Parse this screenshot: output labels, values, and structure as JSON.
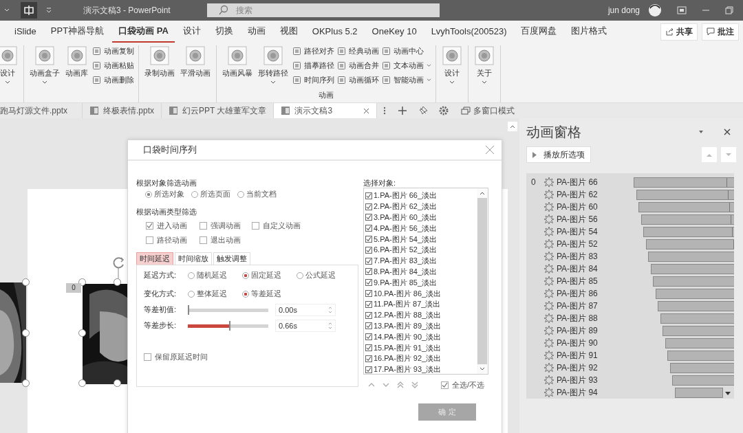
{
  "titlebar": {
    "title": "演示文稿3  -  PowerPoint",
    "search_placeholder": "搜索",
    "user": "jun dong"
  },
  "ribbon_tabs": [
    {
      "label": "iSlide",
      "selected": false
    },
    {
      "label": "PPT神器导航",
      "selected": false
    },
    {
      "label": "口袋动画 PA",
      "selected": true
    },
    {
      "label": "设计",
      "selected": false
    },
    {
      "label": "切换",
      "selected": false
    },
    {
      "label": "动画",
      "selected": false
    },
    {
      "label": "视图",
      "selected": false
    },
    {
      "label": "OKPlus 5.2",
      "selected": false
    },
    {
      "label": "OneKey 10",
      "selected": false
    },
    {
      "label": "LvyhTools(200523)",
      "selected": false
    },
    {
      "label": "百度网盘",
      "selected": false
    },
    {
      "label": "图片格式",
      "selected": false
    }
  ],
  "share_buttons": [
    "共享",
    "批注"
  ],
  "ribbon_groups": [
    {
      "items": [
        {
          "kind": "large",
          "label": "设计",
          "dropdown": true
        }
      ]
    },
    {
      "items": [
        {
          "kind": "large",
          "label": "动画盒子",
          "dropdown": true
        },
        {
          "kind": "large",
          "label": "动画库",
          "dropdown": false
        },
        {
          "kind": "column",
          "items": [
            {
              "label": "动画复制",
              "dropdown": false
            },
            {
              "label": "动画粘贴",
              "dropdown": false
            },
            {
              "label": "动画删除",
              "dropdown": false
            }
          ]
        }
      ]
    },
    {
      "items": [
        {
          "kind": "large",
          "label": "录制动画",
          "dropdown": false
        },
        {
          "kind": "large",
          "label": "平滑动画",
          "dropdown": false
        }
      ]
    },
    {
      "label": "动画",
      "items": [
        {
          "kind": "large",
          "label": "动画风暴",
          "dropdown": false
        },
        {
          "kind": "large",
          "label": "形转路径",
          "dropdown": true
        },
        {
          "kind": "column",
          "items": [
            {
              "label": "路径对齐",
              "dropdown": false
            },
            {
              "label": "描摹路径",
              "dropdown": false
            },
            {
              "label": "时间序列",
              "dropdown": false
            }
          ]
        },
        {
          "kind": "column",
          "items": [
            {
              "label": "经典动画",
              "dropdown": false
            },
            {
              "label": "动画合并",
              "dropdown": false
            },
            {
              "label": "动画循环",
              "dropdown": false
            }
          ]
        },
        {
          "kind": "column",
          "items": [
            {
              "label": "动画中心",
              "dropdown": false
            },
            {
              "label": "文本动画",
              "dropdown": true
            },
            {
              "label": "智能动画",
              "dropdown": true
            }
          ]
        }
      ]
    },
    {
      "items": [
        {
          "kind": "large",
          "label": "设计",
          "dropdown": true
        }
      ]
    },
    {
      "items": [
        {
          "kind": "large",
          "label": "关于",
          "dropdown": true
        }
      ]
    }
  ],
  "doc_tabs": [
    {
      "label": "跑马灯源文件.pptx",
      "selected": false
    },
    {
      "label": "终极表情.pptx",
      "selected": false
    },
    {
      "label": "幻云PPT 大雄董军文章",
      "selected": false
    },
    {
      "label": "演示文稿3",
      "selected": true
    }
  ],
  "multi_window_button": "多窗口模式",
  "slide": {
    "tag": "0"
  },
  "dialog": {
    "title": "口袋时间序列",
    "object_filter": {
      "label": "根据对象筛选动画",
      "options": [
        {
          "label": "所选对象",
          "selected": true
        },
        {
          "label": "所选页面",
          "selected": false
        },
        {
          "label": "当前文档",
          "selected": false
        }
      ]
    },
    "type_filter": {
      "label": "根据动画类型筛选",
      "options": [
        {
          "label": "进入动画",
          "checked": true
        },
        {
          "label": "强调动画",
          "checked": false
        },
        {
          "label": "自定义动画",
          "checked": false
        },
        {
          "label": "路径动画",
          "checked": false
        },
        {
          "label": "退出动画",
          "checked": false
        }
      ]
    },
    "tabs": [
      {
        "label": "时间延迟",
        "selected": true
      },
      {
        "label": "时间缩放",
        "selected": false
      },
      {
        "label": "触发调整",
        "selected": false
      }
    ],
    "delay_mode": {
      "label": "延迟方式:",
      "options": [
        {
          "label": "随机延迟",
          "selected": false
        },
        {
          "label": "固定延迟",
          "selected": true
        },
        {
          "label": "公式延迟",
          "selected": false
        }
      ]
    },
    "change_mode": {
      "label": "变化方式:",
      "options": [
        {
          "label": "整体延迟",
          "selected": false
        },
        {
          "label": "等差延迟",
          "selected": true
        }
      ]
    },
    "sliders": [
      {
        "label": "等差初值:",
        "level": 0,
        "value": "0.00s"
      },
      {
        "label": "等差步长:",
        "level": 0.51,
        "value": "0.66s"
      }
    ],
    "keep_delay": {
      "label": "保留原延迟时间",
      "checked": false
    },
    "objects": {
      "label": "选择对象:",
      "items": [
        {
          "label": "1.PA-图片 66_淡出",
          "checked": true
        },
        {
          "label": "2.PA-图片 62_淡出",
          "checked": true
        },
        {
          "label": "3.PA-图片 60_淡出",
          "checked": true
        },
        {
          "label": "4.PA-图片 56_淡出",
          "checked": true
        },
        {
          "label": "5.PA-图片 54_淡出",
          "checked": true
        },
        {
          "label": "6.PA-图片 52_淡出",
          "checked": true
        },
        {
          "label": "7.PA-图片 83_淡出",
          "checked": true
        },
        {
          "label": "8.PA-图片 84_淡出",
          "checked": true
        },
        {
          "label": "9.PA-图片 85_淡出",
          "checked": true
        },
        {
          "label": "10.PA-图片 86_淡出",
          "checked": true
        },
        {
          "label": "11.PA-图片 87_淡出",
          "checked": true
        },
        {
          "label": "12.PA-图片 88_淡出",
          "checked": true
        },
        {
          "label": "13.PA-图片 89_淡出",
          "checked": true
        },
        {
          "label": "14.PA-图片 90_淡出",
          "checked": true
        },
        {
          "label": "15.PA-图片 91_淡出",
          "checked": true
        },
        {
          "label": "16.PA-图片 92_淡出",
          "checked": true
        },
        {
          "label": "17.PA-图片 93_淡出",
          "checked": true
        }
      ]
    },
    "select_all": {
      "label": "全选/不选",
      "checked": true
    },
    "ok_button": "确 定"
  },
  "animation_pane": {
    "title": "动画窗格",
    "play_button": "播放所选项",
    "rows": [
      {
        "number": "0",
        "name": "PA-图片 66"
      },
      {
        "name": "PA-图片 62"
      },
      {
        "name": "PA-图片 60"
      },
      {
        "name": "PA-图片 56"
      },
      {
        "name": "PA-图片 54"
      },
      {
        "name": "PA-图片 52"
      },
      {
        "name": "PA-图片 83"
      },
      {
        "name": "PA-图片 84"
      },
      {
        "name": "PA-图片 85"
      },
      {
        "name": "PA-图片 86"
      },
      {
        "name": "PA-图片 87"
      },
      {
        "name": "PA-图片 88"
      },
      {
        "name": "PA-图片 89"
      },
      {
        "name": "PA-图片 90"
      },
      {
        "name": "PA-图片 91"
      },
      {
        "name": "PA-图片 92"
      },
      {
        "name": "PA-图片 93"
      },
      {
        "name": "PA-图片 94"
      }
    ]
  }
}
